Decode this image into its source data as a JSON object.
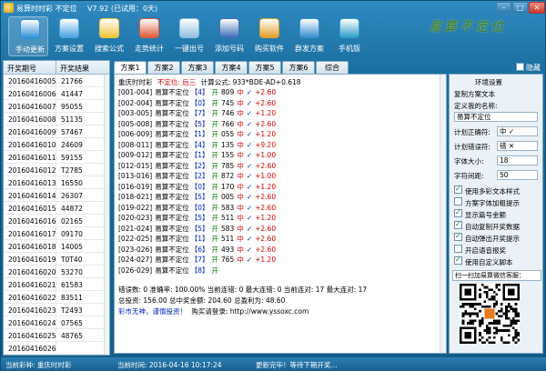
{
  "window": {
    "title": "易算时时彩 不定位",
    "version": "V7.92 (已试用：0天)",
    "min_icon": "minimize-icon",
    "max_icon": "maximize-icon",
    "close_icon": "close-icon"
  },
  "toolbar": {
    "items": [
      {
        "label": "手动更新",
        "icon": "refresh-icon",
        "color": "#2f8fd8"
      },
      {
        "label": "方案设置",
        "icon": "settings-icon",
        "color": "#4aa3df"
      },
      {
        "label": "搜索公式",
        "icon": "search-icon",
        "color": "#f0c23a"
      },
      {
        "label": "走势统计",
        "icon": "trend-chart-icon",
        "color": "#e05a3a"
      },
      {
        "label": "一键出号",
        "icon": "dice-icon",
        "color": "#8fbfe0"
      },
      {
        "label": "添加号码",
        "icon": "add-number-icon",
        "color": "#3f6fb8"
      },
      {
        "label": "购买软件",
        "icon": "key-icon",
        "color": "#e0a02a"
      },
      {
        "label": "群发方案",
        "icon": "group-send-icon",
        "color": "#3a8fd0"
      },
      {
        "label": "手机版",
        "icon": "mobile-icon",
        "color": "#2fa0c8"
      }
    ],
    "brand": "易算不定位"
  },
  "left_list": {
    "header_period": "开奖期号",
    "header_result": "开奖结果",
    "rows": [
      [
        "20160416005",
        "21766"
      ],
      [
        "20160416006",
        "41447"
      ],
      [
        "20160416007",
        "95055"
      ],
      [
        "20160416008",
        "51135"
      ],
      [
        "20160416009",
        "57467"
      ],
      [
        "20160416010",
        "24609"
      ],
      [
        "20160416011",
        "59155"
      ],
      [
        "20160416012",
        "T2785"
      ],
      [
        "20160416013",
        "16550"
      ],
      [
        "20160416014",
        "26307"
      ],
      [
        "20160416015",
        "44872"
      ],
      [
        "20160416016",
        "02165"
      ],
      [
        "20160416017",
        "09170"
      ],
      [
        "20160416018",
        "14005"
      ],
      [
        "20160416019",
        "T0T40"
      ],
      [
        "20160416020",
        "53270"
      ],
      [
        "20160416021",
        "61583"
      ],
      [
        "20160416022",
        "83511"
      ],
      [
        "20160416023",
        "T2493"
      ],
      [
        "20160416024",
        "07565"
      ],
      [
        "20160416025",
        "48765"
      ],
      [
        "20160416026",
        ""
      ]
    ]
  },
  "tabs": [
    "方案1",
    "方案2",
    "方案3",
    "方案4",
    "方案5",
    "方案6",
    "综合"
  ],
  "hide_label": "隐藏",
  "main": {
    "header_name": "重庆时时彩",
    "header_mode": "不定位: 后三",
    "header_formula": "计算公式: 933*BDE-AD+0.618",
    "records": [
      {
        "id": "[001-004]",
        "name": "易算不定位",
        "num": "4",
        "lbl": "开",
        "res": "809",
        "hit": "中",
        "mark": "✓",
        "amt": "+2.60"
      },
      {
        "id": "[002-004]",
        "name": "易算不定位",
        "num": "0",
        "lbl": "开",
        "res": "745",
        "hit": "中",
        "mark": "✓",
        "amt": "+2.60"
      },
      {
        "id": "[003-005]",
        "name": "易算不定位",
        "num": "7",
        "lbl": "开",
        "res": "746",
        "hit": "中",
        "mark": "✓",
        "amt": "+1.20"
      },
      {
        "id": "[005-008]",
        "name": "易算不定位",
        "num": "5",
        "lbl": "开",
        "res": "766",
        "hit": "中",
        "mark": "✓",
        "amt": "+2.60"
      },
      {
        "id": "[006-009]",
        "name": "易算不定位",
        "num": "1",
        "lbl": "开",
        "res": "055",
        "hit": "中",
        "mark": "✓",
        "amt": "+1.20"
      },
      {
        "id": "[008-011]",
        "name": "易算不定位",
        "num": "4",
        "lbl": "开",
        "res": "135",
        "hit": "中",
        "mark": "✓",
        "amt": "+9.20"
      },
      {
        "id": "[009-012]",
        "name": "易算不定位",
        "num": "1",
        "lbl": "开",
        "res": "155",
        "hit": "中",
        "mark": "✓",
        "amt": "+1.00"
      },
      {
        "id": "[012-015]",
        "name": "易算不定位",
        "num": "2",
        "lbl": "开",
        "res": "785",
        "hit": "中",
        "mark": "✓",
        "amt": "+2.60"
      },
      {
        "id": "[013-016]",
        "name": "易算不定位",
        "num": "2",
        "lbl": "开",
        "res": "872",
        "hit": "中",
        "mark": "✓",
        "amt": "+1.00"
      },
      {
        "id": "[016-019]",
        "name": "易算不定位",
        "num": "0",
        "lbl": "开",
        "res": "170",
        "hit": "中",
        "mark": "✓",
        "amt": "+1.20"
      },
      {
        "id": "[018-021]",
        "name": "易算不定位",
        "num": "5",
        "lbl": "开",
        "res": "005",
        "hit": "中",
        "mark": "✓",
        "amt": "+2.60"
      },
      {
        "id": "[019-022]",
        "name": "易算不定位",
        "num": "0",
        "lbl": "开",
        "res": "583",
        "hit": "中",
        "mark": "✓",
        "amt": "+2.60"
      },
      {
        "id": "[020-023]",
        "name": "易算不定位",
        "num": "5",
        "lbl": "开",
        "res": "511",
        "hit": "中",
        "mark": "✓",
        "amt": "+1.20"
      },
      {
        "id": "[021-024]",
        "name": "易算不定位",
        "num": "5",
        "lbl": "开",
        "res": "583",
        "hit": "中",
        "mark": "✓",
        "amt": "+2.60"
      },
      {
        "id": "[022-025]",
        "name": "易算不定位",
        "num": "1",
        "lbl": "开",
        "res": "511",
        "hit": "中",
        "mark": "✓",
        "amt": "+2.60"
      },
      {
        "id": "[023-026]",
        "name": "易算不定位",
        "num": "6",
        "lbl": "开",
        "res": "493",
        "hit": "中",
        "mark": "✓",
        "amt": "+2.60"
      },
      {
        "id": "[024-027]",
        "name": "易算不定位",
        "num": "7",
        "lbl": "开",
        "res": "765",
        "hit": "中",
        "mark": "✓",
        "amt": "+1.20"
      },
      {
        "id": "[026-029]",
        "name": "易算不定位",
        "num": "8",
        "lbl": "开",
        "res": "",
        "hit": "",
        "mark": "",
        "amt": ""
      }
    ],
    "summary1": "错误数: 0  准确率: 100.00%  当前连错: 0  最大连错: 0  当前连对: 17  最大连对: 17",
    "summary2": "总投资: 156.00  总中奖金额: 204.60  总盈利为: 48.60",
    "footer_slogan": "彩市无神，谨慎投资！",
    "footer_buy": "购买请登录: http://www.yssoxc.com"
  },
  "settings": {
    "title": "环境设置",
    "copy_text_label": "复制方案文本",
    "custom_name_label": "定义我的名称:",
    "custom_name_value": "易算不定位",
    "hit_symbol_label": "计划正确符:",
    "hit_symbol_value": "中 ✓",
    "miss_symbol_label": "计划错误符:",
    "miss_symbol_value": "错 ✕",
    "font_size_label": "字体大小:",
    "font_size_value": "18",
    "char_width_label": "字符间距:",
    "char_width_value": "50",
    "options": [
      {
        "label": "使用多彩文本样式",
        "checked": true
      },
      {
        "label": "方案字体加粗提示",
        "checked": false
      },
      {
        "label": "显示篇号金额",
        "checked": true
      },
      {
        "label": "自动复制开奖数据",
        "checked": true
      },
      {
        "label": "自动弹出开奖提示",
        "checked": true
      },
      {
        "label": "开启语音报奖",
        "checked": false
      },
      {
        "label": "使用自定义脚本",
        "checked": true
      }
    ],
    "qr_title": "扫一扫加易算微信客服："
  },
  "status": {
    "lottery": "当前彩种: 重庆时时彩",
    "time": "当前时间: 2016-04-16 10:17:24",
    "update": "更新完毕！等待下期开奖..."
  }
}
